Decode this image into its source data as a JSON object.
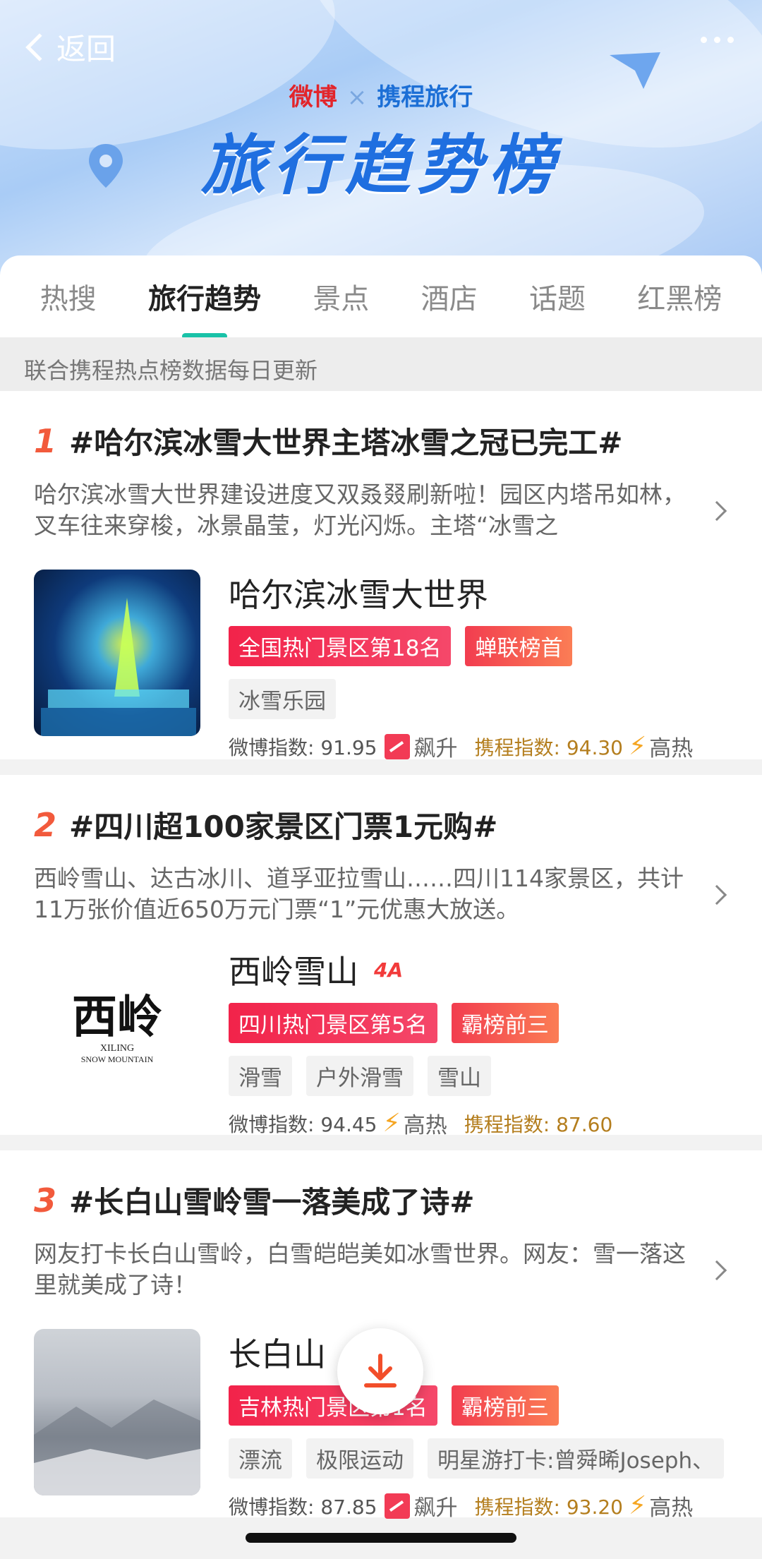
{
  "header": {
    "back_label": "返回",
    "brand_weibo": "微博",
    "brand_x": "×",
    "brand_ctrip": "携程旅行",
    "title": "旅行趋势榜"
  },
  "tabs": [
    {
      "label": "热搜",
      "active": false
    },
    {
      "label": "旅行趋势",
      "active": true
    },
    {
      "label": "景点",
      "active": false
    },
    {
      "label": "酒店",
      "active": false
    },
    {
      "label": "话题",
      "active": false
    },
    {
      "label": "红黑榜",
      "active": false
    }
  ],
  "notice": "联合携程热点榜数据每日更新",
  "items": [
    {
      "rank": "1",
      "title": "#哈尔滨冰雪大世界主塔冰雪之冠已完工#",
      "desc": "哈尔滨冰雪大世界建设进度又双叒叕刷新啦！园区内塔吊如林，叉车往来穿梭，冰景晶莹，灯光闪烁。主塔“冰雪之",
      "poi_name": "哈尔滨冰雪大世界",
      "level": "",
      "badges": [
        "全国热门景区第18名",
        "蝉联榜首"
      ],
      "tags": [
        "冰雪乐园"
      ],
      "weibo_index_label": "微博指数: 91.95",
      "weibo_trend": "飙升",
      "ctrip_index_label": "携程指数: 94.30",
      "ctrip_trend": "高热"
    },
    {
      "rank": "2",
      "title": "#四川超100家景区门票1元购#",
      "desc": "西岭雪山、达古冰川、道孚亚拉雪山……四川114家景区，共计11万张价值近650万元门票“1”元优惠大放送。",
      "poi_name": "西岭雪山",
      "level": "4A",
      "badges": [
        "四川热门景区第5名",
        "霸榜前三"
      ],
      "tags": [
        "滑雪",
        "户外滑雪",
        "雪山"
      ],
      "weibo_index_label": "微博指数: 94.45",
      "weibo_trend": "高热",
      "ctrip_index_label": "携程指数: 87.60",
      "ctrip_trend": "",
      "logo_text": "西岭",
      "logo_sub1": "XILING",
      "logo_sub2": "SNOW MOUNTAIN"
    },
    {
      "rank": "3",
      "title": "#长白山雪岭雪一落美成了诗#",
      "desc": "网友打卡长白山雪岭，白雪皑皑美如冰雪世界。网友：雪一落这里就美成了诗！",
      "poi_name": "长白山",
      "level": "",
      "badges": [
        "吉林热门景区第1名",
        "霸榜前三"
      ],
      "tags": [
        "漂流",
        "极限运动",
        "明星游打卡:曾舜晞Joseph、"
      ],
      "weibo_index_label": "微博指数: 87.85",
      "weibo_trend": "飙升",
      "ctrip_index_label": "携程指数: 93.20",
      "ctrip_trend": "高热"
    }
  ],
  "colors": {
    "accent_tab": "#19c2a8",
    "rank": "#f25a3c",
    "badge_red": "#f2234a",
    "ctrip_text": "#b47e1e"
  },
  "icons": [
    "back-chevron-icon",
    "more-dots-icon",
    "chevron-right-icon",
    "rise-icon",
    "fire-icon",
    "download-icon"
  ]
}
